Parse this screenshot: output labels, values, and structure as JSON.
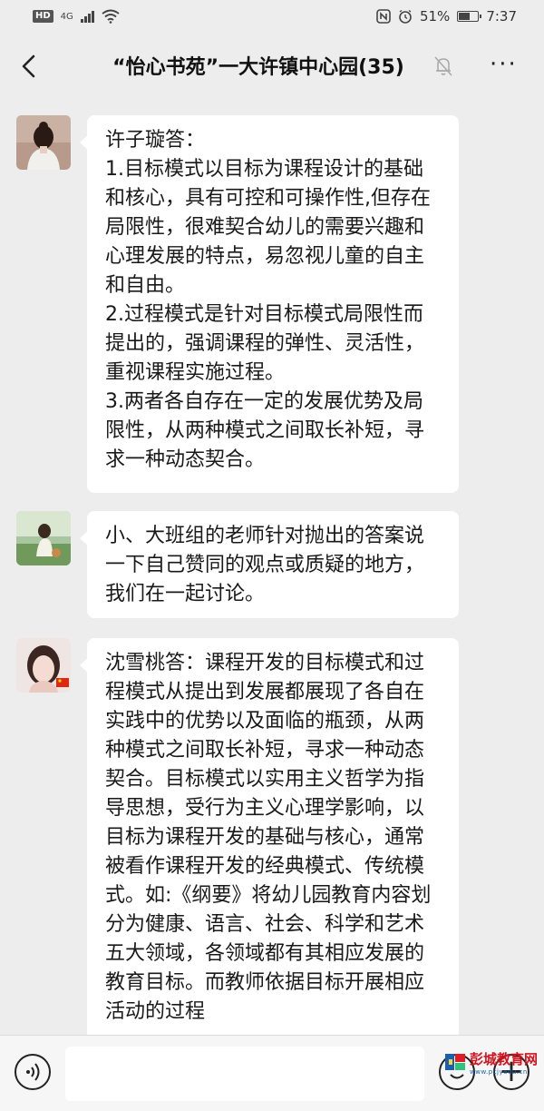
{
  "status_bar": {
    "hd": "HD",
    "network": "4G",
    "battery_percent": "51%",
    "battery_level": 0.51,
    "time": "7:37",
    "icons": [
      "nfc-icon",
      "alarm-icon",
      "battery-icon",
      "wifi-icon"
    ]
  },
  "header": {
    "title": "“怡心书苑”一大许镇中心园(35)",
    "icons": [
      "back-arrow-icon",
      "mute-bell-icon",
      "more-icon"
    ]
  },
  "messages": [
    {
      "text": "许子璇答：\n1.目标模式以目标为课程设计的基础和核心，具有可控和可操作性,但存在局限性，很难契合幼儿的需要兴趣和心理发展的特点，易忽视儿童的自主和自由。\n2.过程模式是针对目标模式局限性而提出的，强调课程的弹性、灵活性，重视课程实施过程。\n3.两者各自存在一定的发展优势及局限性，从两种模式之间取长补短，寻求一种动态契合。"
    },
    {
      "text": "小、大班组的老师针对抛出的答案说一下自己赞同的观点或质疑的地方，我们在一起讨论。"
    },
    {
      "text": "沈雪桃答：课程开发的目标模式和过程模式从提出到发展都展现了各自在实践中的优势以及面临的瓶颈，从两种模式之间取长补短，寻求一种动态契合。目标模式以实用主义哲学为指导思想，受行为主义心理学影响，以目标为课程开发的基础与核心，通常被看作课程开发的经典模式、传统模式。如:《纲要》将幼儿园教育内容划分为健康、语言、社会、科学和艺术五大领域，各领域都有其相应发展的教育目标。而教师依据目标开展相应活动的过程"
    }
  ],
  "input_bar": {
    "icons": [
      "voice-icon",
      "emoji-icon",
      "plus-icon"
    ]
  },
  "watermark": {
    "text": "彭城教育网",
    "url": "www.pcjyedu.cn"
  }
}
